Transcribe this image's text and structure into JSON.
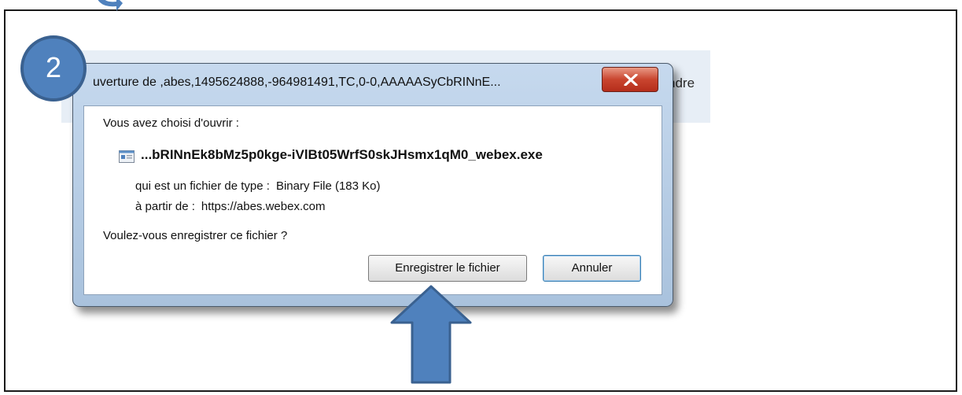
{
  "step": {
    "number": "2"
  },
  "background": {
    "partial_text": "ndre"
  },
  "dialog": {
    "title": "uverture de ,abes,1495624888,-964981491,TC,0-0,AAAAASyCbRINnE...",
    "prompt": "Vous avez choisi d'ouvrir :",
    "filename": "...bRINnEk8bMz5p0kge-iVlBt05WrfS0skJHsmx1qM0_webex.exe",
    "type_label": "qui est un fichier de type :",
    "type_value": "Binary File (183 Ko)",
    "from_label": "à partir de :",
    "from_value": "https://abes.webex.com",
    "question": "Voulez-vous enregistrer ce fichier ?",
    "save_button": "Enregistrer le fichier",
    "cancel_button": "Annuler"
  },
  "icons": {
    "close": "close-icon",
    "file": "executable-file-icon",
    "pointer": "up-arrow-icon"
  },
  "colors": {
    "annotation_blue": "#4f81bd",
    "close_red": "#c9452f"
  }
}
